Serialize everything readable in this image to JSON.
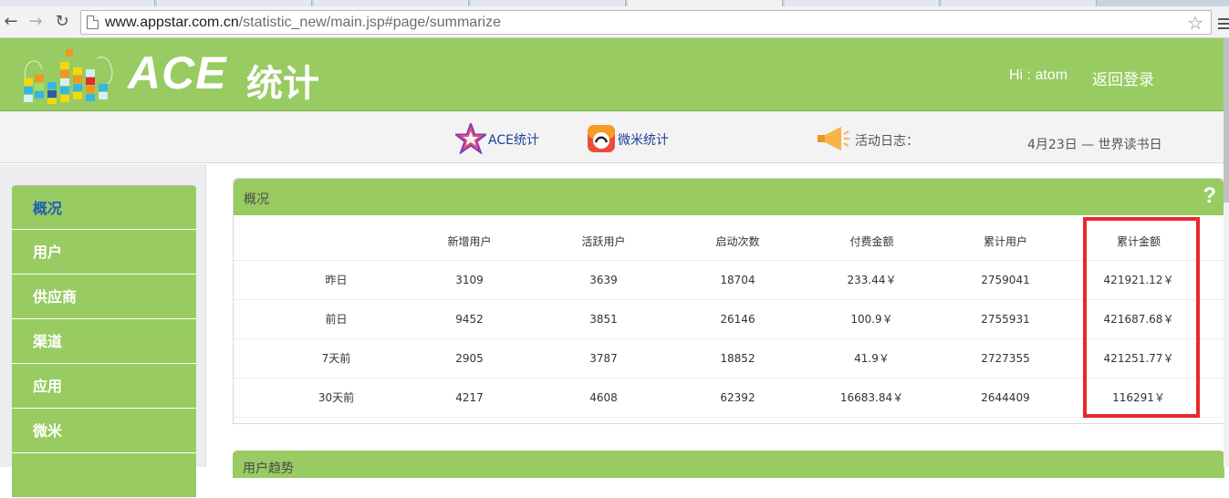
{
  "browser": {
    "url_host": "www.appstar.com.cn",
    "url_path": "/statistic_new/main.jsp#page/summarize"
  },
  "header": {
    "logo_text": "ACE",
    "logo_suffix": "统计",
    "greeting": "Hi : atom",
    "relogin": "返回登录"
  },
  "subnav": {
    "ace_link": "ACE统计",
    "weimi_link": "微米统计",
    "activity_label": "活动日志：",
    "activity_value": "4月23日 — 世界读书日"
  },
  "sidebar": {
    "items": [
      {
        "label": "概况",
        "active": true
      },
      {
        "label": "用户",
        "active": false
      },
      {
        "label": "供应商",
        "active": false
      },
      {
        "label": "渠道",
        "active": false
      },
      {
        "label": "应用",
        "active": false
      },
      {
        "label": "微米",
        "active": false
      }
    ]
  },
  "overview": {
    "title": "概况",
    "help": "?",
    "columns": [
      "",
      "新增用户",
      "活跃用户",
      "启动次数",
      "付费金额",
      "累计用户",
      "累计金额"
    ],
    "rows": [
      [
        "昨日",
        "3109",
        "3639",
        "18704",
        "233.44￥",
        "2759041",
        "421921.12￥"
      ],
      [
        "前日",
        "9452",
        "3851",
        "26146",
        "100.9￥",
        "2755931",
        "421687.68￥"
      ],
      [
        "7天前",
        "2905",
        "3787",
        "18852",
        "41.9￥",
        "2727355",
        "421251.77￥"
      ],
      [
        "30天前",
        "4217",
        "4608",
        "62392",
        "16683.84￥",
        "2644409",
        "116291￥"
      ]
    ]
  },
  "next_panel": {
    "title": "用户趋势"
  },
  "colors": {
    "brand_green": "#98cb62",
    "highlight_red": "#e8282d",
    "active_link": "#1f5eb5"
  }
}
